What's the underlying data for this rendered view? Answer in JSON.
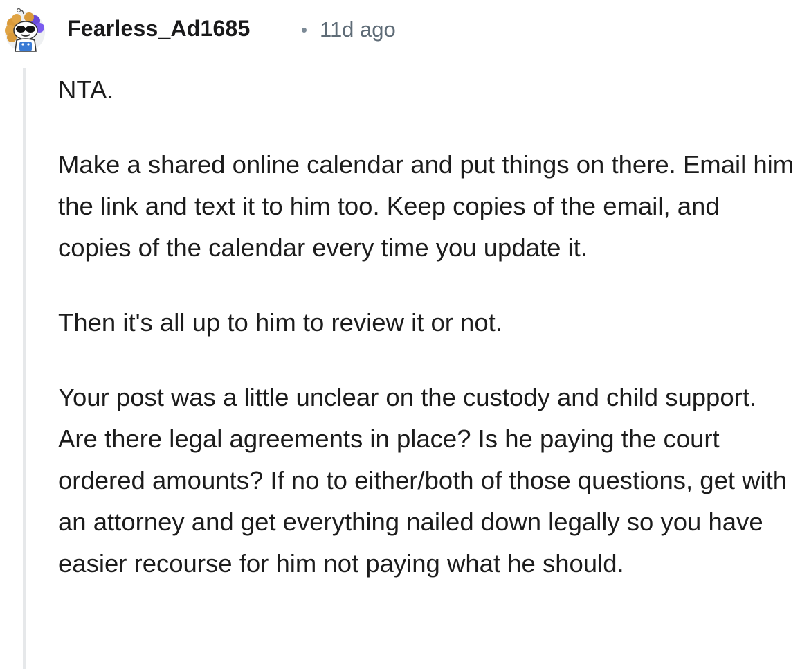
{
  "comment": {
    "author": "Fearless_Ad1685",
    "separator": "•",
    "timestamp": "11d ago",
    "avatar_icon": "snoo-avatar-sunglasses-curly-hair",
    "paragraphs": [
      "NTA.",
      "Make a shared online calendar and put things on there. Email him the link and text it to him too. Keep copies of the email, and copies of the calendar every time you update it.",
      "Then it's all up to him to review it or not.",
      "Your post was a little unclear on the custody and child support. Are there legal agreements in place? Is he paying the court ordered amounts? If no to either/both of those questions, get with an attorney and get everything nailed down legally so you have easier recourse for him not paying what he should."
    ]
  },
  "colors": {
    "username": "#1a1a1b",
    "timestamp": "#5f6c77",
    "body_text": "#1c1c1c",
    "thread_line": "#e6e8ea",
    "avatar_hair": "#d99a3a",
    "avatar_accent": "#6a4bd8"
  }
}
